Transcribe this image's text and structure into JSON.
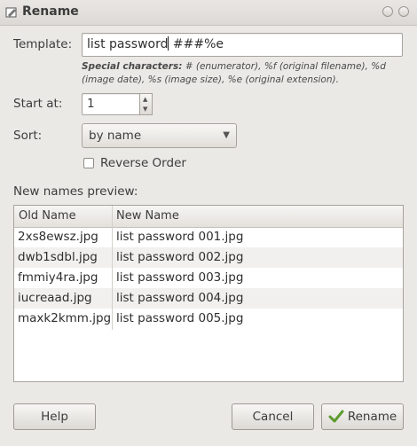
{
  "window": {
    "title": "Rename"
  },
  "template": {
    "label": "Template:",
    "value_before_cursor": "list password",
    "value_after_cursor": " ###%e"
  },
  "special_chars": {
    "heading": "Special characters:",
    "text": " # (enumerator), %f (original filename), %d (image date), %s (image size), %e (original extension)."
  },
  "start_at": {
    "label": "Start at:",
    "value": "1"
  },
  "sort": {
    "label": "Sort:",
    "selected": "by name"
  },
  "reverse_order": {
    "label": "Reverse Order",
    "checked": false
  },
  "preview": {
    "label": "New names preview:",
    "columns": [
      "Old Name",
      "New Name"
    ],
    "rows": [
      {
        "old": "2xs8ewsz.jpg",
        "new": "list password 001.jpg"
      },
      {
        "old": "dwb1sdbl.jpg",
        "new": "list password 002.jpg"
      },
      {
        "old": "fmmiy4ra.jpg",
        "new": "list password 003.jpg"
      },
      {
        "old": "iucreaad.jpg",
        "new": "list password 004.jpg"
      },
      {
        "old": "maxk2kmm.jpg",
        "new": "list password 005.jpg"
      }
    ]
  },
  "buttons": {
    "help": "Help",
    "cancel": "Cancel",
    "rename": "Rename"
  }
}
